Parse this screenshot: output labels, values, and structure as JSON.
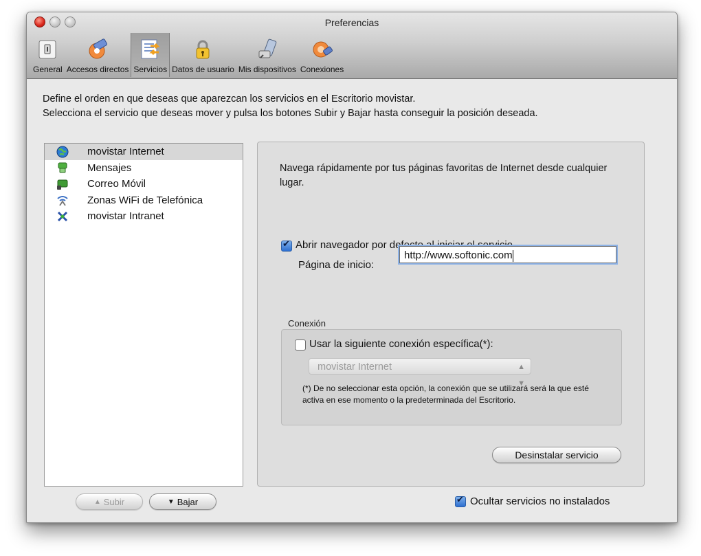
{
  "window": {
    "title": "Preferencias"
  },
  "toolbar": {
    "items": [
      {
        "label": "General",
        "icon": "general-icon"
      },
      {
        "label": "Accesos directos",
        "icon": "shortcuts-icon"
      },
      {
        "label": "Servicios",
        "icon": "services-icon",
        "active": true
      },
      {
        "label": "Datos de usuario",
        "icon": "user-data-icon"
      },
      {
        "label": "Mis dispositivos",
        "icon": "devices-icon"
      },
      {
        "label": "Conexiones",
        "icon": "connections-icon"
      }
    ]
  },
  "description": {
    "line1": "Define el orden en que deseas que aparezcan los servicios en el Escritorio movistar.",
    "line2": "Selecciona el servicio que deseas mover y pulsa los botones Subir y Bajar hasta conseguir la posición deseada."
  },
  "services": [
    {
      "label": "movistar Internet",
      "icon": "globe-icon",
      "selected": true
    },
    {
      "label": "Mensajes",
      "icon": "messages-icon"
    },
    {
      "label": "Correo Móvil",
      "icon": "mail-icon"
    },
    {
      "label": "Zonas WiFi de Telefónica",
      "icon": "wifi-icon"
    },
    {
      "label": "movistar Intranet",
      "icon": "intranet-icon"
    }
  ],
  "buttons": {
    "up": "Subir",
    "down": "Bajar",
    "uninstall": "Desinstalar servicio"
  },
  "detail": {
    "description": "Navega rápidamente por tus páginas favoritas de Internet desde cualquier lugar.",
    "open_browser_label": "Abrir navegador por defecto al iniciar el servicio",
    "open_browser_checked": true,
    "home_page_label": "Página de inicio:",
    "home_page_value": "http://www.softonic.com",
    "connection": {
      "title": "Conexión",
      "use_specific_label": "Usar la siguiente conexión específica(*):",
      "use_specific_checked": false,
      "selected": "movistar Internet",
      "note": "(*) De no seleccionar esta opción, la conexión que se utilizará será la que esté activa en ese momento o la predeterminada del Escritorio."
    }
  },
  "hide_uninstalled": {
    "label": "Ocultar servicios no instalados",
    "checked": true
  }
}
